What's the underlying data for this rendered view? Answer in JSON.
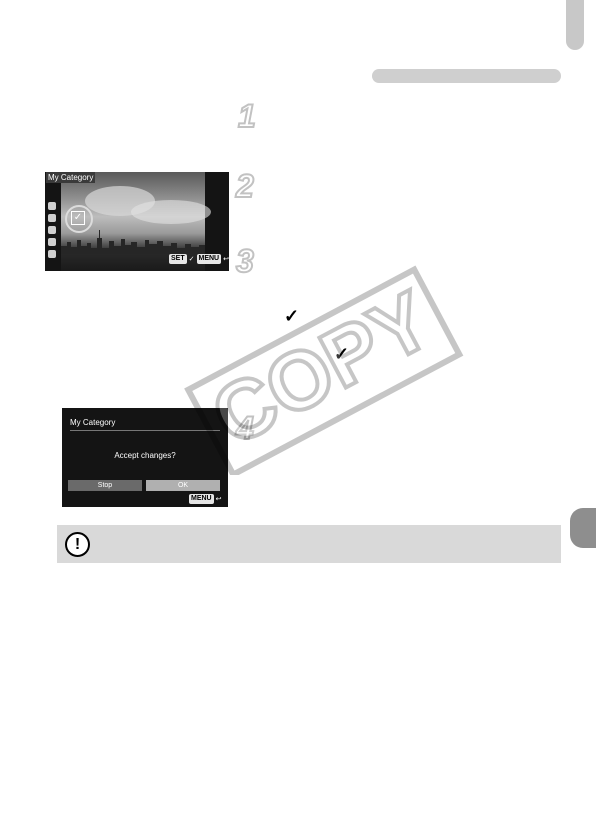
{
  "steps": [
    "1",
    "2",
    "3",
    "4"
  ],
  "screen1": {
    "title": "My Category",
    "check_mark": "✓",
    "footer": {
      "set_key": "SET",
      "check": "✓",
      "menu_key": "MENU",
      "back": "↩"
    }
  },
  "body_ticks": [
    "✓",
    "✓"
  ],
  "screen2": {
    "title": "My Category",
    "message": "Accept changes?",
    "stop_label": "Stop",
    "ok_label": "OK",
    "footer": {
      "menu_key": "MENU",
      "back": "↩"
    }
  },
  "caution": {
    "icon": "!"
  },
  "watermark": {
    "text": "COPY"
  }
}
